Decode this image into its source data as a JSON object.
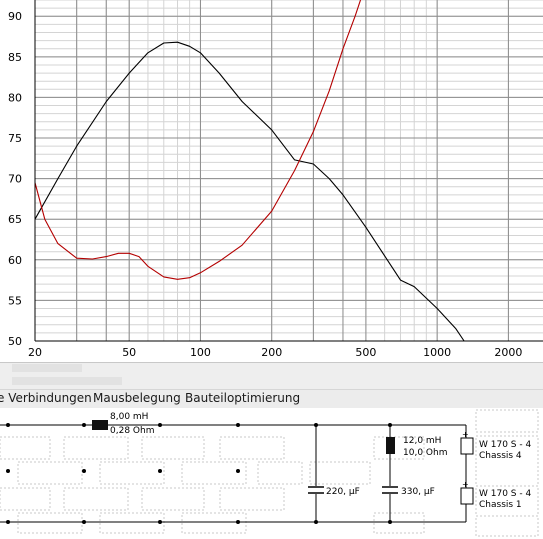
{
  "chart_data": {
    "type": "line",
    "x_scale": "log",
    "xlim": [
      20,
      2800
    ],
    "ylim": [
      50,
      92
    ],
    "grid": true,
    "x_ticks": [
      20,
      50,
      100,
      200,
      500,
      1000,
      2000
    ],
    "x_tick_labels": [
      "20",
      "50",
      "100",
      "200",
      "500",
      "1000",
      "2000"
    ],
    "y_ticks": [
      50,
      55,
      60,
      65,
      70,
      75,
      80,
      85,
      90
    ],
    "y_tick_labels": [
      "50",
      "55",
      "60",
      "65",
      "70",
      "75",
      "80",
      "85",
      "90"
    ],
    "series": [
      {
        "color": "#000000",
        "x": [
          20,
          25,
          30,
          40,
          50,
          60,
          70,
          80,
          90,
          100,
          120,
          150,
          200,
          250,
          300,
          350,
          400,
          500,
          600,
          700,
          800,
          1000,
          1200,
          1300,
          1500,
          2000,
          2800
        ],
        "y": [
          65,
          70,
          74,
          79.5,
          83,
          85.5,
          86.7,
          86.8,
          86.3,
          85.5,
          83,
          79.5,
          76,
          72.3,
          71.8,
          70,
          68,
          64,
          60.5,
          57.5,
          56.7,
          54,
          51.5,
          50,
          50,
          50,
          50
        ]
      },
      {
        "color": "#b40000",
        "x": [
          20,
          22,
          25,
          30,
          35,
          40,
          45,
          50,
          55,
          60,
          70,
          80,
          90,
          100,
          120,
          150,
          200,
          250,
          300,
          350,
          400,
          450,
          500
        ],
        "y": [
          69.5,
          65,
          62,
          60.2,
          60.1,
          60.4,
          60.8,
          60.8,
          60.4,
          59.2,
          57.9,
          57.6,
          57.8,
          58.4,
          59.8,
          61.8,
          66,
          71,
          75.8,
          80.8,
          86,
          90,
          94
        ]
      }
    ]
  },
  "tab_bar": {
    "items": [
      {
        "id": "verbindungen",
        "label": "e Verbindungen"
      },
      {
        "id": "mausbelegung",
        "label": "Mausbelegung"
      },
      {
        "id": "bauteiloptimierung",
        "label": "Bauteiloptimierung"
      }
    ]
  },
  "schematic": {
    "inductor_series": {
      "value": "8,00 mH",
      "resistance": "0,28 Ohm"
    },
    "capacitor_1": {
      "value": "220, µF"
    },
    "inductor_shunt": {
      "value": "12,0 mH",
      "resistance": "10,0 Ohm"
    },
    "capacitor_2": {
      "value": "330, µF"
    },
    "driver_top": {
      "name": "W 170 S - 4",
      "chassis": "Chassis 4"
    },
    "driver_bottom": {
      "name": "W 170 S - 4",
      "chassis": "Chassis 1"
    }
  }
}
